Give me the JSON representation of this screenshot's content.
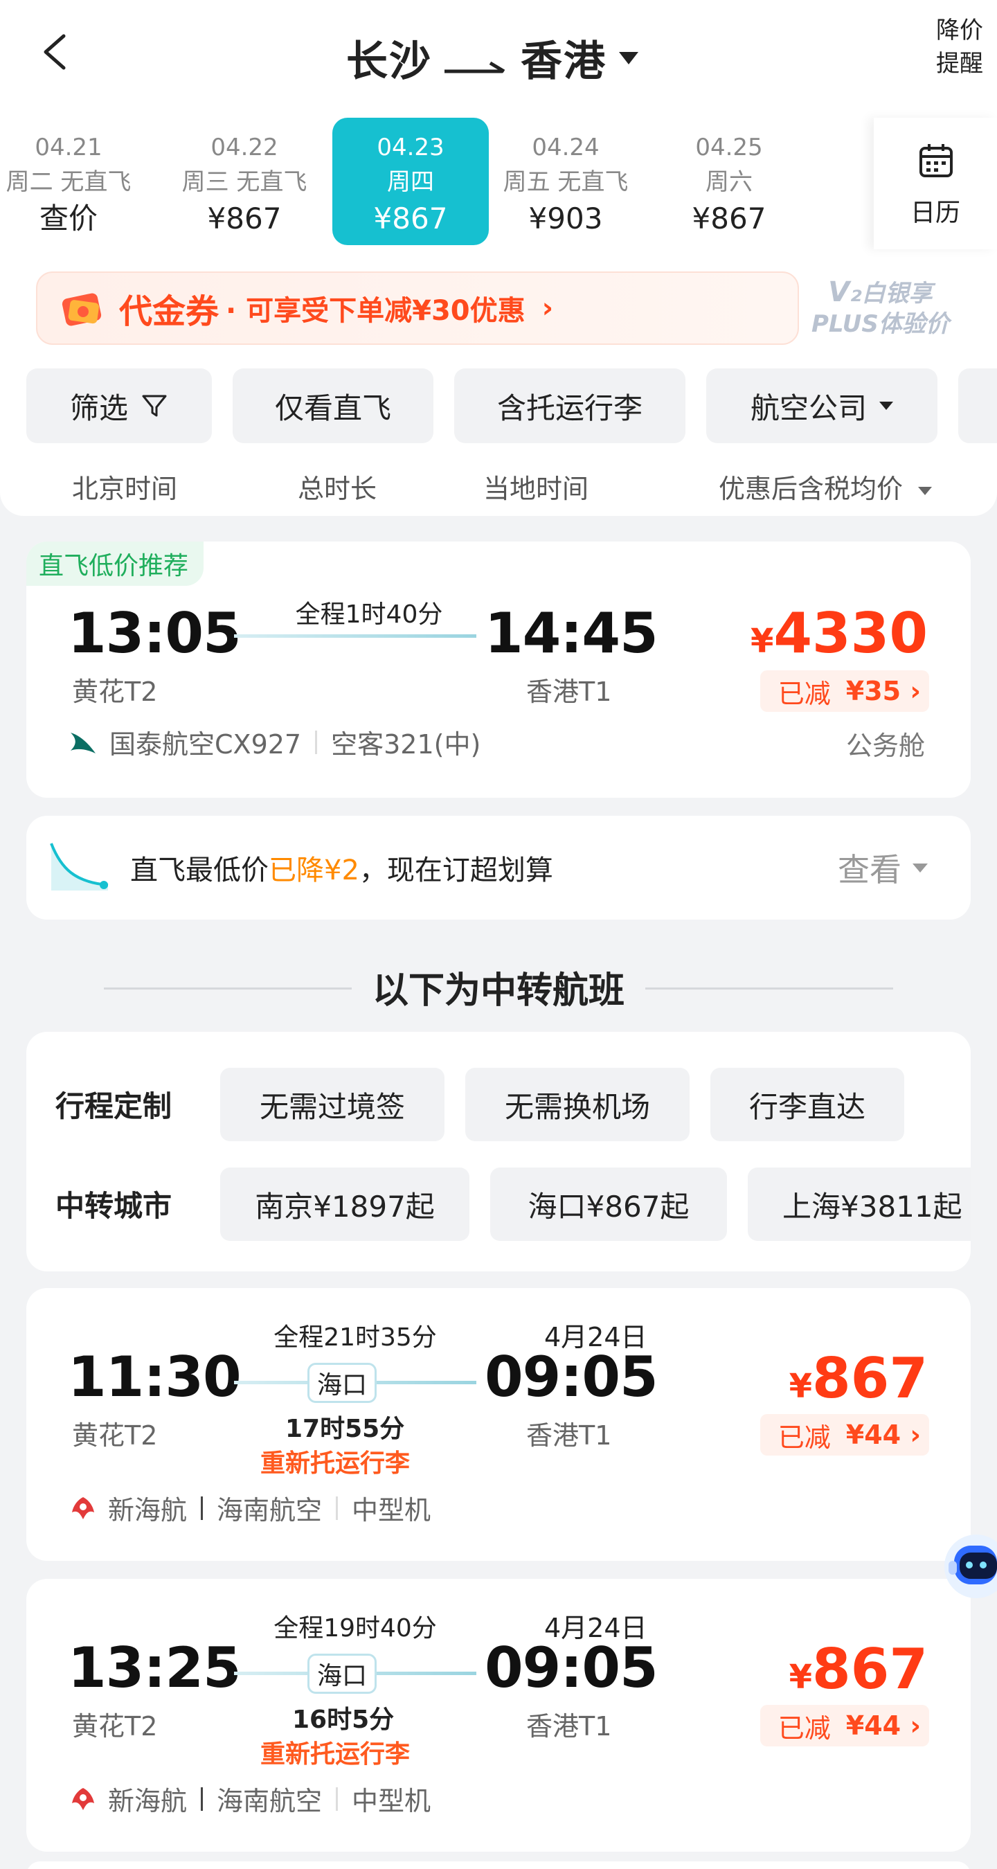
{
  "header": {
    "origin": "长沙",
    "destination": "香港",
    "price_alert": [
      "降价",
      "提醒"
    ]
  },
  "dates": [
    {
      "date": "04.21",
      "info": "周二 无直飞",
      "price": "查价",
      "selected": false
    },
    {
      "date": "04.22",
      "info": "周三 无直飞",
      "price": "¥867",
      "selected": false
    },
    {
      "date": "04.23",
      "info": "周四",
      "price": "¥867",
      "selected": true
    },
    {
      "date": "04.24",
      "info": "周五 无直飞",
      "price": "¥903",
      "selected": false
    },
    {
      "date": "04.25",
      "info": "周六",
      "price": "¥867",
      "selected": false
    }
  ],
  "calendar_label": "日历",
  "coupon": {
    "title": "代金券",
    "desc": "· 可享受下单减¥30优惠",
    "arrow": "›"
  },
  "vip": {
    "line1": "白银享",
    "line2": "PLUS体验价"
  },
  "filters": [
    "筛选",
    "仅看直飞",
    "含托运行李",
    "航空公司"
  ],
  "sort": [
    "北京时间",
    "总时长",
    "当地时间",
    "优惠后含税均价"
  ],
  "direct": {
    "tag": "直飞低价推荐",
    "dep_time": "13:05",
    "dep_airport": "黄花T2",
    "duration": "全程1时40分",
    "arr_time": "14:45",
    "arr_airport": "香港T1",
    "price_yen": "¥",
    "price": "4330",
    "reduced_label": "已减",
    "reduced_amt": "¥35 ›",
    "airline": "国泰航空CX927",
    "aircraft": "空客321(中)",
    "cabin": "公务舱"
  },
  "price_drop": {
    "prefix": "直飞最低价",
    "highlight": "已降¥2",
    "suffix": "，现在订超划算",
    "action": "查看"
  },
  "transfer_title": "以下为中转航班",
  "customize": {
    "label1": "行程定制",
    "opts": [
      "无需过境签",
      "无需换机场",
      "行李直达"
    ],
    "label2": "中转城市",
    "cities": [
      "南京¥1897起",
      "海口¥867起",
      "上海¥3811起"
    ]
  },
  "transfers": [
    {
      "dep_time": "11:30",
      "dep_airport": "黄花T2",
      "duration": "全程21时35分",
      "stop": "海口",
      "stop_time": "17时55分",
      "warn": "重新托运行李",
      "arr_date": "4月24日",
      "arr_time": "09:05",
      "arr_airport": "香港T1",
      "price_yen": "¥",
      "price": "867",
      "reduced_label": "已减",
      "reduced_amt": "¥44 ›",
      "airline1": "新海航",
      "airline2": "海南航空",
      "aircraft": "中型机"
    },
    {
      "dep_time": "13:25",
      "dep_airport": "黄花T2",
      "duration": "全程19时40分",
      "stop": "海口",
      "stop_time": "16时5分",
      "warn": "重新托运行李",
      "arr_date": "4月24日",
      "arr_time": "09:05",
      "arr_airport": "香港T1",
      "price_yen": "¥",
      "price": "867",
      "reduced_label": "已减",
      "reduced_amt": "¥44 ›",
      "airline1": "新海航",
      "airline2": "海南航空",
      "aircraft": "中型机"
    }
  ],
  "colors": {
    "accent": "#16c0d0",
    "price": "#ff3b14",
    "green": "#1fae5c"
  }
}
